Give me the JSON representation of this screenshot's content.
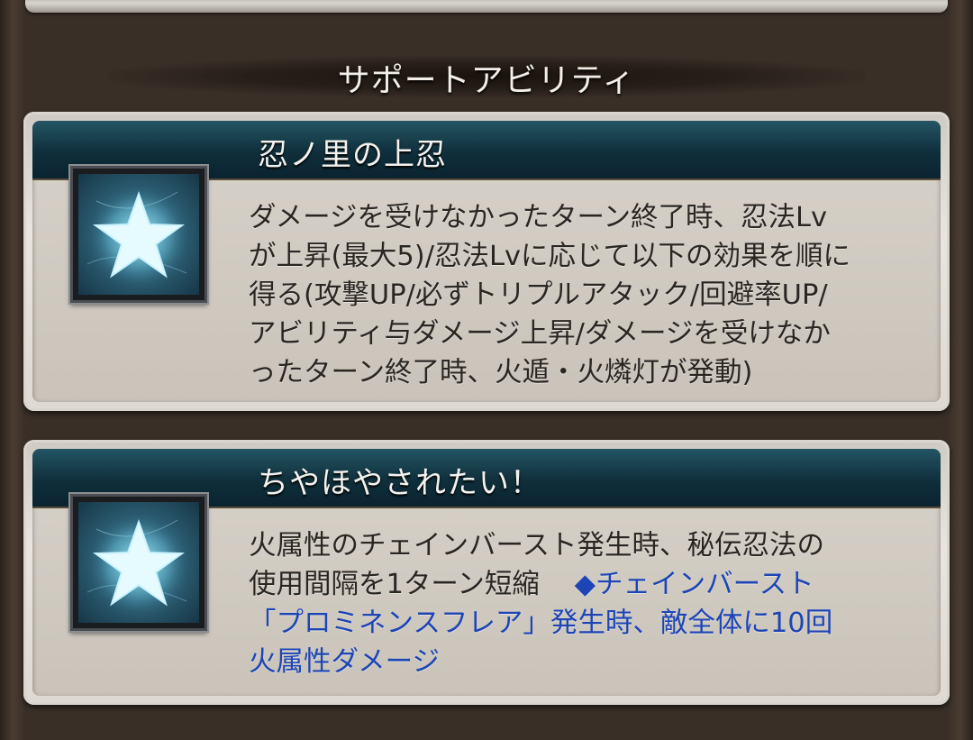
{
  "section_title": "サポートアビリティ",
  "abilities": [
    {
      "name": "忍ノ里の上忍",
      "icon": "star-icon",
      "description_lines": [
        "ダメージを受けなかったターン終了時、忍法Lv",
        "が上昇(最大5)/忍法Lvに応じて以下の効果を順に",
        "得る(攻撃UP/必ずトリプルアタック/回避率UP/",
        "アビリティ与ダメージ上昇/ダメージを受けなか",
        "ったターン終了時、火遁・火燐灯が発動)"
      ]
    },
    {
      "name": "ちやほやされたい！",
      "icon": "star-icon",
      "description_line1": "火属性のチェインバースト発生時、秘伝忍法の",
      "description_line2": "使用間隔を1ターン短縮",
      "highlight_line2": "◆チェインバースト",
      "highlight_line3": "「プロミネンスフレア」発生時、敵全体に10回",
      "highlight_line4": "火属性ダメージ"
    }
  ],
  "colors": {
    "header_teal": "#0f2f3b",
    "highlight_blue": "#1d45b5",
    "text_dark": "#2a2622"
  }
}
